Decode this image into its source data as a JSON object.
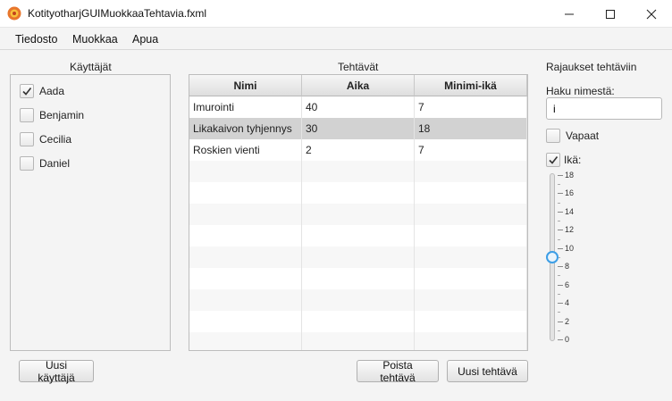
{
  "window": {
    "title": "KotityotharjGUIMuokkaaTehtavia.fxml",
    "controls": {
      "minimize": "minimize-icon",
      "maximize": "maximize-icon",
      "close": "close-icon"
    }
  },
  "menu": [
    "Tiedosto",
    "Muokkaa",
    "Apua"
  ],
  "users": {
    "label": "Käyttäjät",
    "items": [
      {
        "name": "Aada",
        "checked": true
      },
      {
        "name": "Benjamin",
        "checked": false
      },
      {
        "name": "Cecilia",
        "checked": false
      },
      {
        "name": "Daniel",
        "checked": false
      }
    ],
    "new_user_button": "Uusi käyttäjä"
  },
  "tasks": {
    "label": "Tehtävät",
    "columns": [
      "Nimi",
      "Aika",
      "Minimi-ikä"
    ],
    "rows": [
      [
        "Imurointi",
        "40",
        "7"
      ],
      [
        "Likakaivon tyhjennys",
        "30",
        "18"
      ],
      [
        "Roskien vienti",
        "2",
        "7"
      ]
    ],
    "selected_row": 1,
    "delete_button": "Poista tehtävä",
    "new_button": "Uusi tehtävä"
  },
  "filters": {
    "label": "Rajaukset tehtäviin",
    "search_label": "Haku nimestä:",
    "search_value": "i",
    "free_label": "Vapaat",
    "free_checked": false,
    "age_label": "Ikä:",
    "age_checked": true,
    "age_slider": {
      "min": 0,
      "max": 18,
      "value": 9,
      "major_ticks": [
        "18",
        "16",
        "14",
        "12",
        "10",
        "8",
        "6",
        "4",
        "2",
        "0"
      ]
    }
  },
  "colors": {
    "accent": "#3c9ee6",
    "selected_row": "#d2d2d2"
  }
}
